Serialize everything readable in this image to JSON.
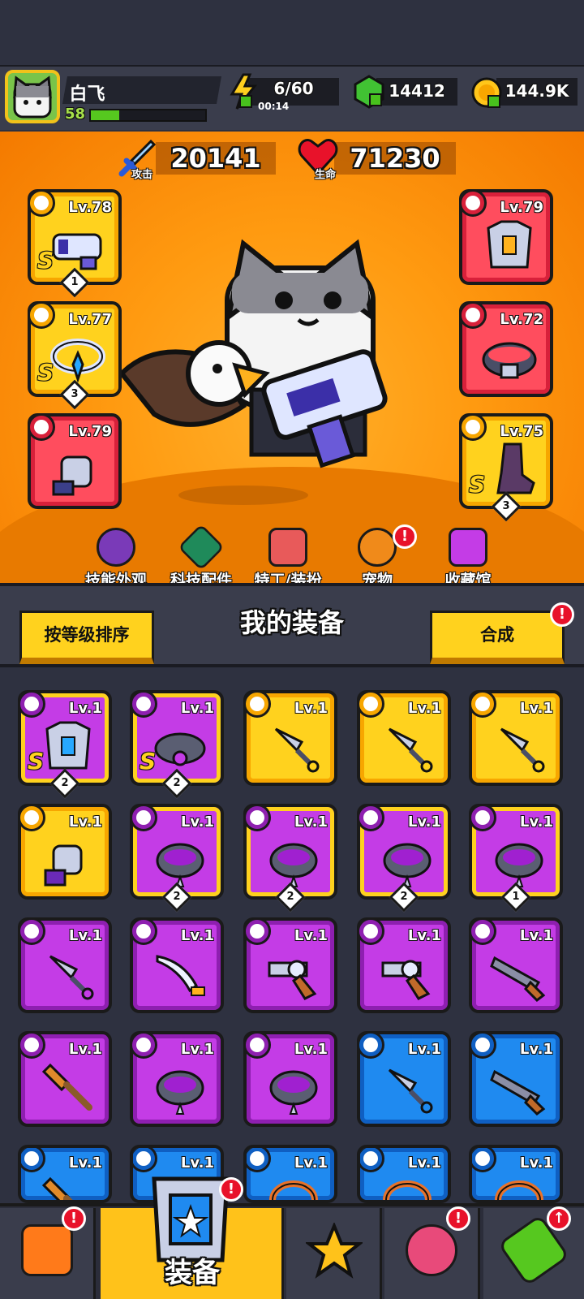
{
  "player": {
    "name": "白飞",
    "level": "58",
    "xp_fraction": 0.25
  },
  "resources": {
    "energy": "6/60",
    "energy_timer": "00:14",
    "gems": "14412",
    "coins": "144.9K"
  },
  "stats": {
    "attack_label": "攻击",
    "attack": "20141",
    "hp_label": "生命",
    "hp": "71230"
  },
  "equipped": {
    "weapon": {
      "level": "Lv.78",
      "rank": "S",
      "stars": "1"
    },
    "necklace": {
      "level": "Lv.77",
      "rank": "S",
      "stars": "3"
    },
    "gloves": {
      "level": "Lv.79"
    },
    "armor": {
      "level": "Lv.79"
    },
    "belt": {
      "level": "Lv.72"
    },
    "boots": {
      "level": "Lv.75",
      "rank": "S",
      "stars": "3"
    }
  },
  "hero_nav": [
    {
      "label": "技能外观"
    },
    {
      "label": "科技配件"
    },
    {
      "label": "特工/装扮"
    },
    {
      "label": "宠物",
      "badge": "!"
    },
    {
      "label": "收藏馆"
    }
  ],
  "inventory_bar": {
    "sort_label": "按等级排序",
    "title": "我的装备",
    "merge_label": "合成",
    "merge_badge": "!"
  },
  "inventory": [
    {
      "level": "Lv.1",
      "rarity": "purple",
      "frame": "gold",
      "rank": "S",
      "stars": "2",
      "icon": "armor"
    },
    {
      "level": "Lv.1",
      "rarity": "purple",
      "frame": "gold",
      "rank": "S",
      "stars": "2",
      "icon": "belt"
    },
    {
      "level": "Lv.1",
      "rarity": "gold",
      "icon": "kunai"
    },
    {
      "level": "Lv.1",
      "rarity": "gold",
      "icon": "kunai"
    },
    {
      "level": "Lv.1",
      "rarity": "gold",
      "icon": "kunai"
    },
    {
      "level": "Lv.1",
      "rarity": "gold",
      "icon": "gloves"
    },
    {
      "level": "Lv.1",
      "rarity": "purple",
      "frame": "gold",
      "stars": "2",
      "icon": "spiked-ring"
    },
    {
      "level": "Lv.1",
      "rarity": "purple",
      "frame": "gold",
      "stars": "2",
      "icon": "spiked-ring"
    },
    {
      "level": "Lv.1",
      "rarity": "purple",
      "frame": "gold",
      "stars": "2",
      "icon": "spiked-ring"
    },
    {
      "level": "Lv.1",
      "rarity": "purple",
      "frame": "gold",
      "stars": "1",
      "icon": "spiked-ring"
    },
    {
      "level": "Lv.1",
      "rarity": "purple",
      "icon": "kunai"
    },
    {
      "level": "Lv.1",
      "rarity": "purple",
      "icon": "machete"
    },
    {
      "level": "Lv.1",
      "rarity": "purple",
      "icon": "revolver"
    },
    {
      "level": "Lv.1",
      "rarity": "purple",
      "icon": "revolver"
    },
    {
      "level": "Lv.1",
      "rarity": "purple",
      "icon": "shotgun"
    },
    {
      "level": "Lv.1",
      "rarity": "purple",
      "icon": "bat"
    },
    {
      "level": "Lv.1",
      "rarity": "purple",
      "icon": "spiked-ring"
    },
    {
      "level": "Lv.1",
      "rarity": "purple",
      "icon": "spiked-ring"
    },
    {
      "level": "Lv.1",
      "rarity": "blue",
      "icon": "kunai"
    },
    {
      "level": "Lv.1",
      "rarity": "blue",
      "icon": "shotgun"
    },
    {
      "level": "Lv.1",
      "rarity": "blue",
      "icon": "bat"
    },
    {
      "level": "Lv.1",
      "rarity": "blue",
      "icon": "machete"
    },
    {
      "level": "Lv.1",
      "rarity": "blue",
      "icon": "necklace"
    },
    {
      "level": "Lv.1",
      "rarity": "blue",
      "icon": "necklace"
    },
    {
      "level": "Lv.1",
      "rarity": "blue",
      "icon": "necklace"
    }
  ],
  "bottom_nav": [
    {
      "label": "",
      "icon": "shop-icon",
      "badge": "!"
    },
    {
      "label": "装备",
      "icon": "equipment-icon",
      "badge": "!",
      "active": true
    },
    {
      "label": "",
      "icon": "battle-icon"
    },
    {
      "label": "",
      "icon": "world-icon",
      "badge": "!"
    },
    {
      "label": "",
      "icon": "evolve-icon",
      "badge": "↑"
    }
  ],
  "colors": {
    "gold": "#ffd21e",
    "purple": "#c43ce6",
    "blue": "#1f8af0",
    "red": "#ff4d5e",
    "orange_bg": "#ff9a10"
  }
}
